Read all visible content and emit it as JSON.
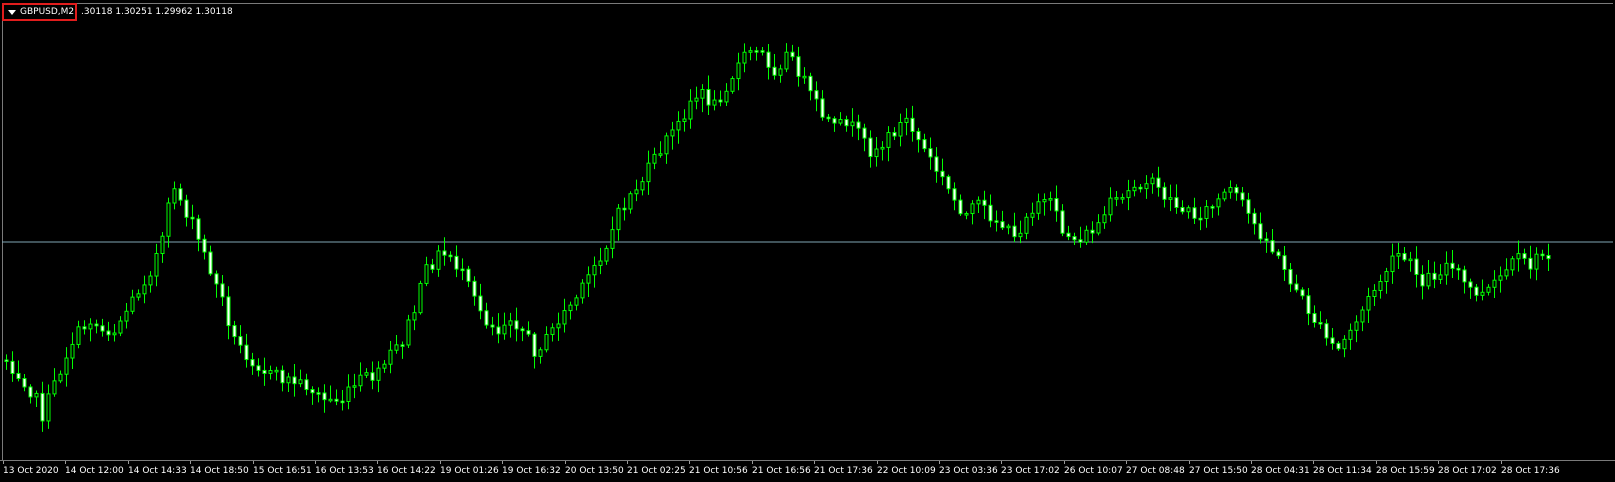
{
  "chart": {
    "symbol": "GBPUSD,M2",
    "ohlc_readout": ".30118 1.30251 1.29962 1.30118",
    "background": "#000000",
    "bull_color": "#00ff00",
    "bear_color": "#ffffff",
    "wick_color": "#00ff00",
    "price_line_color": "#7fa6b4",
    "x_labels": [
      "13 Oct 2020",
      "14 Oct 12:00",
      "14 Oct 14:33",
      "14 Oct 18:50",
      "15 Oct 16:51",
      "16 Oct 13:53",
      "16 Oct 14:22",
      "19 Oct 01:26",
      "19 Oct 16:32",
      "20 Oct 13:50",
      "21 Oct 02:25",
      "21 Oct 10:56",
      "21 Oct 16:56",
      "21 Oct 17:36",
      "22 Oct 10:09",
      "23 Oct 03:36",
      "23 Oct 17:02",
      "26 Oct 10:07",
      "27 Oct 08:48",
      "27 Oct 15:50",
      "28 Oct 04:31",
      "28 Oct 11:34",
      "28 Oct 15:59",
      "28 Oct 17:02",
      "28 Oct 17:36"
    ]
  },
  "chart_data": {
    "type": "candlestick",
    "series": [
      {
        "trend": [
          [
            0,
            360
          ],
          [
            3,
            380
          ],
          [
            5,
            400
          ],
          [
            6,
            415
          ],
          [
            8,
            385
          ],
          [
            11,
            340
          ],
          [
            14,
            320
          ],
          [
            16,
            330
          ],
          [
            18,
            330
          ],
          [
            21,
            300
          ],
          [
            24,
            270
          ],
          [
            26,
            240
          ],
          [
            27,
            210
          ],
          [
            28,
            185
          ],
          [
            29,
            200
          ],
          [
            31,
            225
          ],
          [
            32,
            240
          ],
          [
            34,
            270
          ],
          [
            36,
            300
          ],
          [
            38,
            340
          ],
          [
            41,
            360
          ],
          [
            44,
            375
          ],
          [
            47,
            380
          ],
          [
            50,
            385
          ],
          [
            53,
            400
          ],
          [
            56,
            400
          ],
          [
            59,
            380
          ],
          [
            62,
            375
          ],
          [
            64,
            355
          ],
          [
            66,
            340
          ],
          [
            68,
            310
          ],
          [
            70,
            270
          ],
          [
            72,
            255
          ],
          [
            74,
            255
          ],
          [
            76,
            275
          ],
          [
            78,
            300
          ],
          [
            80,
            320
          ],
          [
            82,
            330
          ],
          [
            84,
            315
          ],
          [
            86,
            330
          ],
          [
            88,
            350
          ],
          [
            90,
            340
          ],
          [
            92,
            320
          ],
          [
            94,
            305
          ],
          [
            96,
            290
          ],
          [
            98,
            265
          ],
          [
            100,
            245
          ],
          [
            102,
            215
          ],
          [
            104,
            195
          ],
          [
            106,
            180
          ],
          [
            108,
            160
          ],
          [
            110,
            140
          ],
          [
            112,
            125
          ],
          [
            114,
            100
          ],
          [
            116,
            95
          ],
          [
            118,
            105
          ],
          [
            120,
            85
          ],
          [
            122,
            65
          ],
          [
            124,
            50
          ],
          [
            126,
            55
          ],
          [
            128,
            70
          ],
          [
            130,
            55
          ],
          [
            132,
            70
          ],
          [
            134,
            95
          ],
          [
            136,
            115
          ],
          [
            138,
            130
          ],
          [
            140,
            120
          ],
          [
            142,
            135
          ],
          [
            144,
            150
          ],
          [
            146,
            145
          ],
          [
            148,
            130
          ],
          [
            150,
            120
          ],
          [
            152,
            140
          ],
          [
            154,
            160
          ],
          [
            156,
            180
          ],
          [
            158,
            200
          ],
          [
            160,
            215
          ],
          [
            162,
            205
          ],
          [
            164,
            215
          ],
          [
            166,
            225
          ],
          [
            168,
            240
          ],
          [
            170,
            215
          ],
          [
            172,
            200
          ],
          [
            174,
            205
          ],
          [
            176,
            230
          ],
          [
            178,
            240
          ],
          [
            180,
            235
          ],
          [
            182,
            225
          ],
          [
            184,
            205
          ],
          [
            186,
            200
          ],
          [
            188,
            185
          ],
          [
            190,
            180
          ],
          [
            192,
            190
          ],
          [
            194,
            200
          ],
          [
            196,
            210
          ],
          [
            198,
            215
          ],
          [
            200,
            210
          ],
          [
            202,
            200
          ],
          [
            204,
            190
          ],
          [
            206,
            205
          ],
          [
            208,
            225
          ],
          [
            210,
            240
          ],
          [
            212,
            260
          ],
          [
            214,
            280
          ],
          [
            216,
            300
          ],
          [
            218,
            320
          ],
          [
            220,
            340
          ],
          [
            222,
            350
          ],
          [
            224,
            330
          ],
          [
            226,
            310
          ],
          [
            228,
            290
          ],
          [
            230,
            270
          ],
          [
            232,
            255
          ],
          [
            234,
            265
          ],
          [
            236,
            280
          ],
          [
            238,
            275
          ],
          [
            240,
            265
          ],
          [
            242,
            275
          ],
          [
            244,
            290
          ],
          [
            246,
            295
          ],
          [
            248,
            285
          ],
          [
            250,
            270
          ],
          [
            252,
            260
          ],
          [
            254,
            265
          ],
          [
            256,
            255
          ],
          [
            258,
            250
          ]
        ]
      }
    ]
  }
}
